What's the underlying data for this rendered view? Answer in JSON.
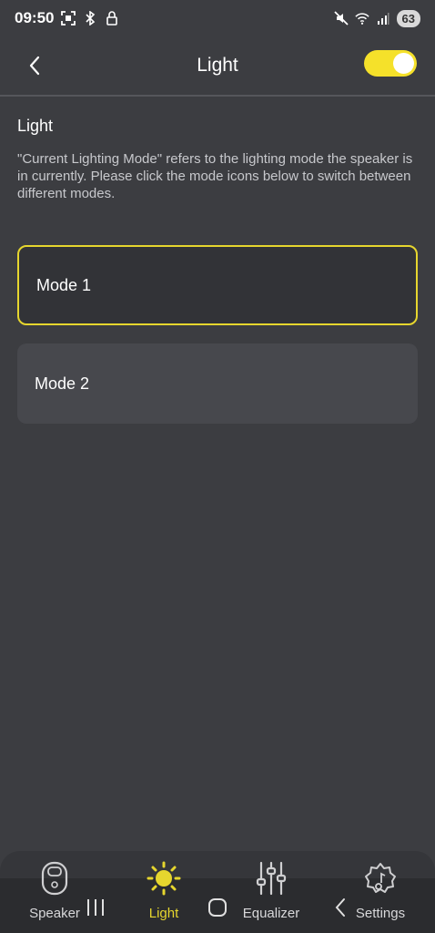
{
  "status_bar": {
    "time": "09:50",
    "battery": "63",
    "icons": [
      "screenshot-icon",
      "bluetooth-icon",
      "lock-icon",
      "mute-icon",
      "wifi-icon",
      "signal-icon"
    ]
  },
  "header": {
    "title": "Light",
    "toggle_on": true,
    "accent_color": "#f5e12a"
  },
  "content": {
    "section_title": "Light",
    "description": "\"Current Lighting Mode\" refers to the lighting mode the speaker is in currently. Please click the mode icons below to switch between different modes.",
    "modes": [
      {
        "label": "Mode 1",
        "selected": true
      },
      {
        "label": "Mode 2",
        "selected": false
      }
    ]
  },
  "bottom_nav": {
    "items": [
      {
        "label": "Speaker",
        "icon": "speaker-icon",
        "active": false
      },
      {
        "label": "Light",
        "icon": "sun-icon",
        "active": true
      },
      {
        "label": "Equalizer",
        "icon": "equalizer-icon",
        "active": false
      },
      {
        "label": "Settings",
        "icon": "settings-icon",
        "active": false
      }
    ]
  },
  "system_nav": {
    "buttons": [
      "recents-button",
      "home-button",
      "back-button"
    ]
  }
}
